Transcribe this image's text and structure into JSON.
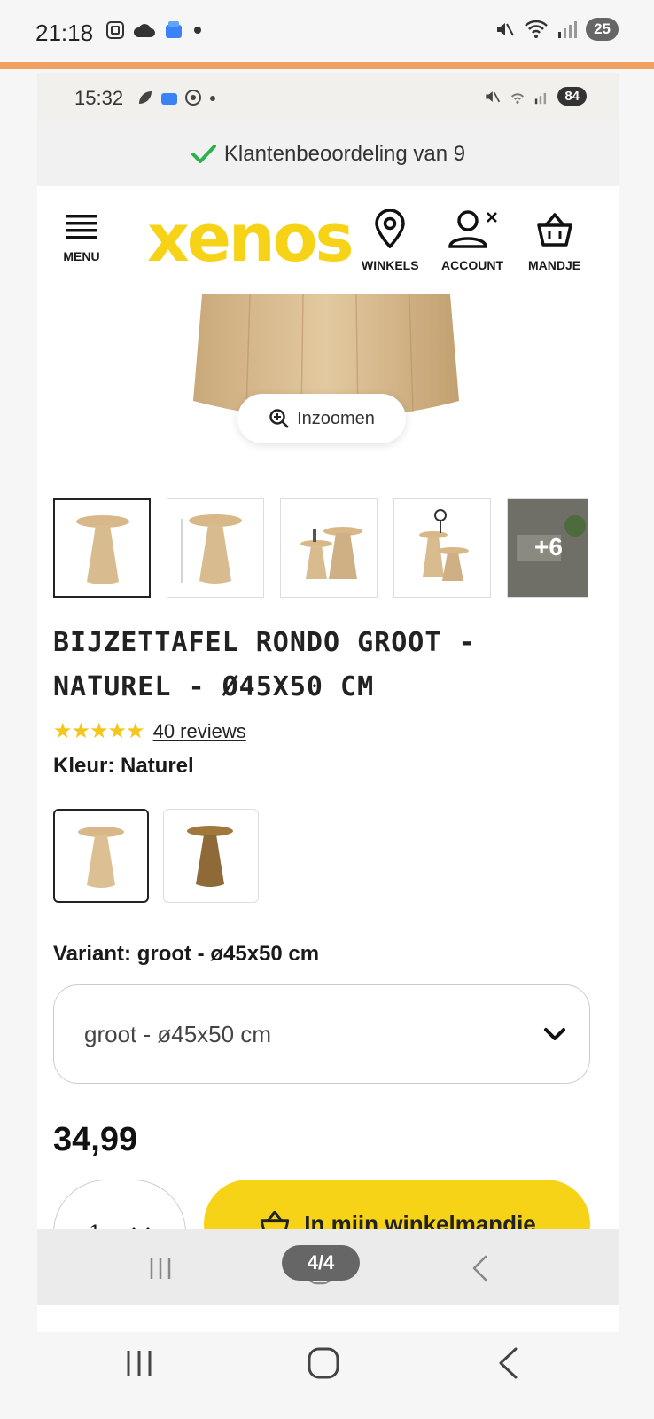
{
  "outer_status": {
    "time": "21:18",
    "battery": "25"
  },
  "inner_status": {
    "time": "15:32",
    "battery": "84"
  },
  "banner": {
    "text": "Klantenbeoordeling van 9",
    "icon": "check-icon",
    "accent": "#2bb24c"
  },
  "header": {
    "logo": "xenos",
    "menu_label": "MENU",
    "stores_label": "WINKELS",
    "account_label": "ACCOUNT",
    "cart_label": "MANDJE",
    "brand_color": "#f7d317"
  },
  "hero": {
    "zoom_label": "Inzoomen"
  },
  "thumbnails": {
    "more_label": "+6"
  },
  "product": {
    "title_line1": "BIJZETTAFEL RONDO GROOT -",
    "title_line2": "NATUREL - Ø45X50 CM",
    "rating": 5,
    "reviews_label": "40 reviews",
    "color_label": "Kleur: Naturel",
    "variant_label": "Variant: groot - ø45x50 cm",
    "variant_value": "groot - ø45x50 cm",
    "price": "34,99",
    "quantity": "1",
    "cart_button": "In miin winkelmandie"
  },
  "inner_nav": {
    "page_indicator": "4/4"
  }
}
